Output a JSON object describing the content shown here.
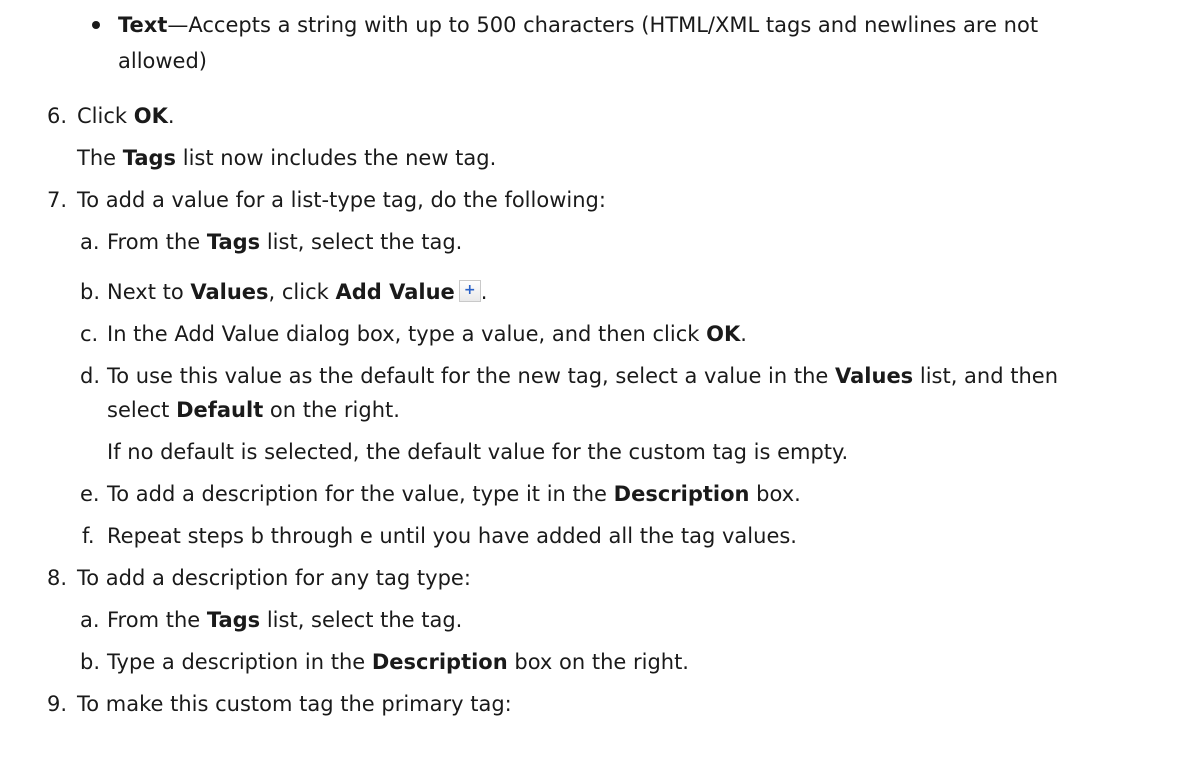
{
  "bullet_text": {
    "term": "Text",
    "desc_line1": "—Accepts a string with up to 500 characters (HTML/XML tags and newlines are not",
    "desc_line2": "allowed)"
  },
  "step6": {
    "num": "6.",
    "pre": "Click ",
    "bold": "OK",
    "post": ".",
    "result_pre": "The ",
    "result_bold": "Tags",
    "result_post": " list now includes the new tag."
  },
  "step7": {
    "num": "7.",
    "text": "To add a value for a list-type tag, do the following:",
    "a": {
      "letter": "a.",
      "pre": "From the ",
      "bold": "Tags",
      "post": " list, select the tag."
    },
    "b": {
      "letter": "b.",
      "pre": "Next to ",
      "bold1": "Values",
      "mid": ", click ",
      "bold2": "Add Value",
      "post": ".",
      "icon": "plus-icon"
    },
    "c": {
      "letter": "c.",
      "pre": "In the Add Value dialog box, type a value, and then click ",
      "bold": "OK",
      "post": "."
    },
    "d": {
      "letter": "d.",
      "pre": "To use this value as the default for the new tag, select a value in the ",
      "bold1": "Values",
      "post1": " list, and then",
      "line2_pre": "select ",
      "bold2": "Default",
      "line2_post": " on the right.",
      "note": "If no default is selected, the default value for the custom tag is empty."
    },
    "e": {
      "letter": "e.",
      "pre": "To add a description for the value, type it in the ",
      "bold": "Description",
      "post": " box."
    },
    "f": {
      "letter": "f.",
      "text": "Repeat steps b through e until you have added all the tag values."
    }
  },
  "step8": {
    "num": "8.",
    "text": "To add a description for any tag type:",
    "a": {
      "letter": "a.",
      "pre": "From the ",
      "bold": "Tags",
      "post": " list, select the tag."
    },
    "b": {
      "letter": "b.",
      "pre": "Type a description in the ",
      "bold": "Description",
      "post": " box on the right."
    }
  },
  "step9": {
    "num": "9.",
    "text": "To make this custom tag the primary tag:"
  }
}
